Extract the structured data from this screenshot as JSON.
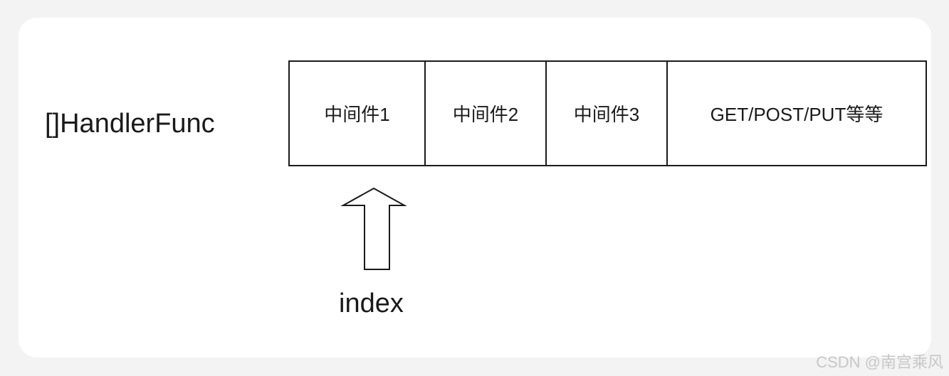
{
  "diagram": {
    "type_label": "[]HandlerFunc",
    "cells": [
      {
        "label": "中间件1"
      },
      {
        "label": "中间件2"
      },
      {
        "label": "中间件3"
      },
      {
        "label": "GET/POST/PUT等等"
      }
    ],
    "pointer_label": "index",
    "pointer_target_cell": 0
  },
  "watermark": "CSDN @南宫乘风",
  "colors": {
    "page_background": "#f3f3f4",
    "card_background": "#ffffff",
    "stroke": "#1a1a1a",
    "watermark": "#c7c7c7"
  }
}
